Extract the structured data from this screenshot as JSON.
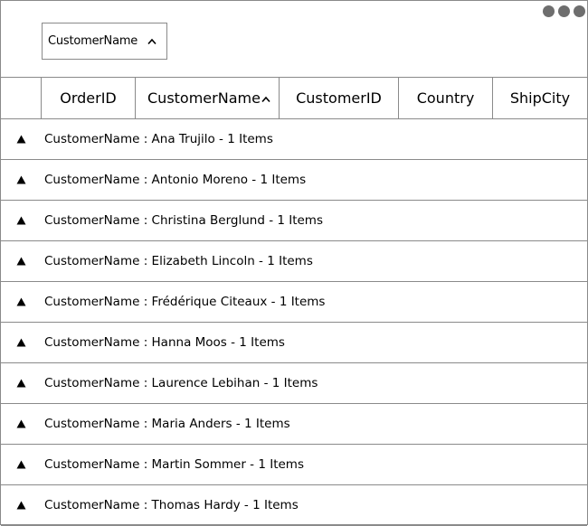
{
  "group_area": {
    "chip_label": "CustomerName",
    "sort_icon": "chevron-up-icon",
    "more_icon": "more-dots-icon"
  },
  "header": {
    "columns": [
      "OrderID",
      "CustomerName",
      "CustomerID",
      "Country",
      "ShipCity"
    ],
    "sorted_column": "CustomerName",
    "sort_icon": "chevron-up-icon"
  },
  "groups": [
    {
      "caption": "CustomerName : Ana Trujilo - 1 Items"
    },
    {
      "caption": "CustomerName : Antonio Moreno - 1 Items"
    },
    {
      "caption": "CustomerName : Christina Berglund - 1 Items"
    },
    {
      "caption": "CustomerName : Elizabeth Lincoln - 1 Items"
    },
    {
      "caption": "CustomerName : Frédérique Citeaux - 1 Items"
    },
    {
      "caption": "CustomerName : Hanna Moos - 1 Items"
    },
    {
      "caption": "CustomerName : Laurence Lebihan - 1 Items"
    },
    {
      "caption": "CustomerName : Maria Anders - 1 Items"
    },
    {
      "caption": "CustomerName : Martin Sommer - 1 Items"
    },
    {
      "caption": "CustomerName : Thomas Hardy - 1 Items"
    }
  ],
  "expander_icon": "triangle-up-icon",
  "colors": {
    "border": "#8a8a8a",
    "dots": "#6e6e6e",
    "text": "#000000"
  }
}
